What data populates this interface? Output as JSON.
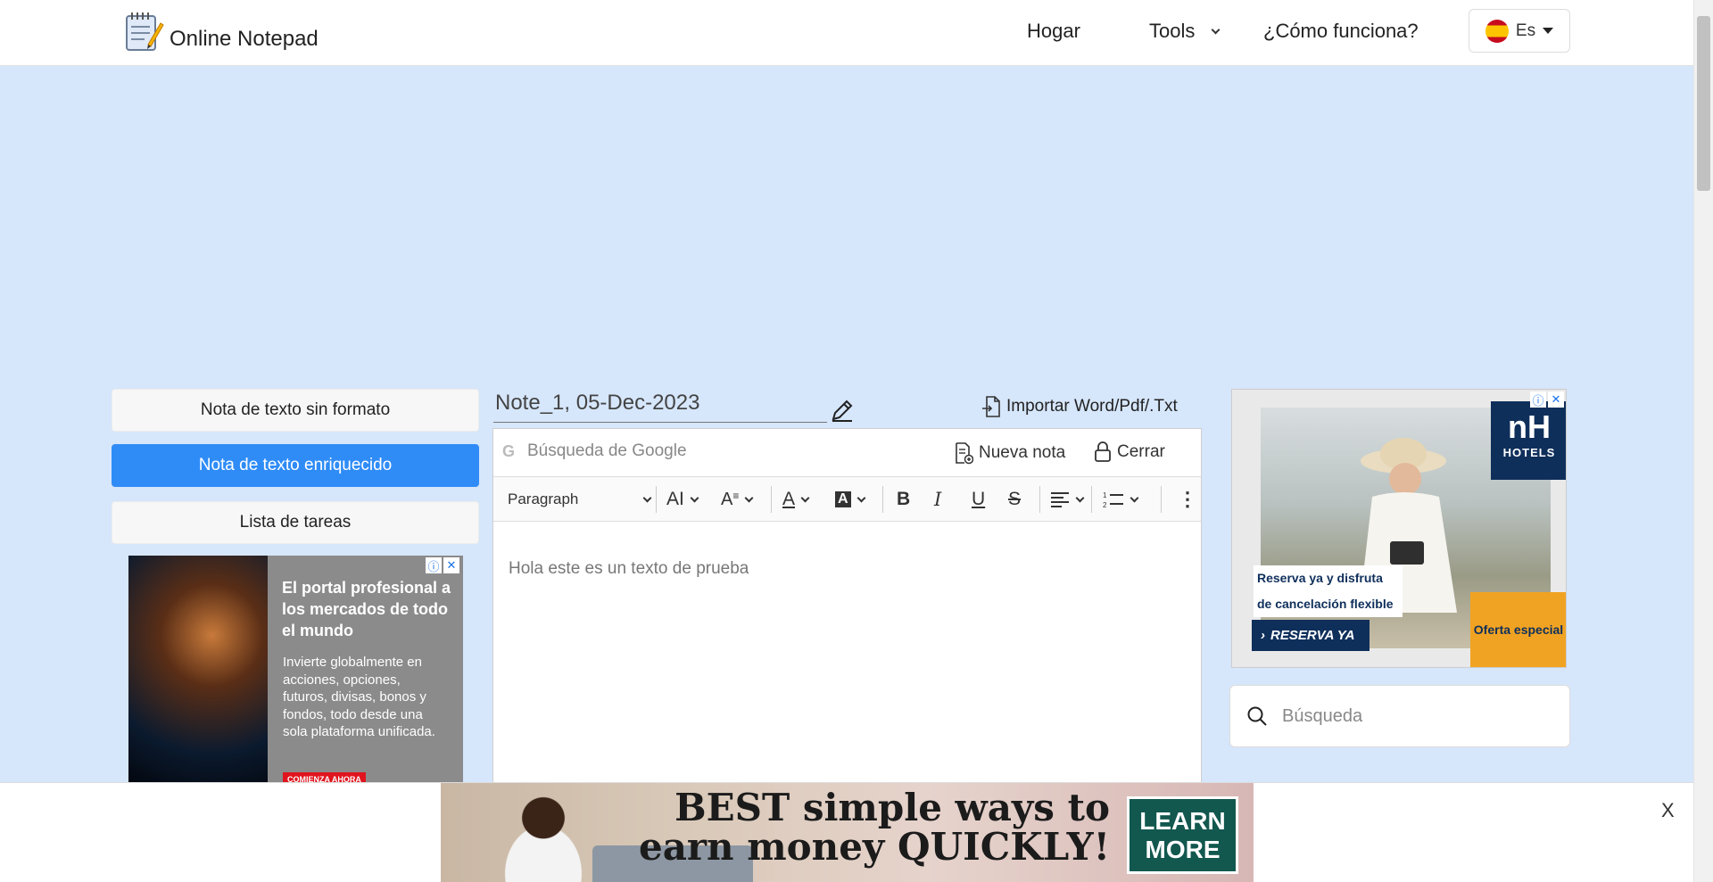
{
  "header": {
    "site_name": "Online Notepad",
    "nav": {
      "home": "Hogar",
      "tools": "Tools",
      "how": "¿Cómo funciona?"
    },
    "lang": "Es"
  },
  "sidebar": {
    "items": [
      {
        "label": "Nota de texto sin formato",
        "active": false
      },
      {
        "label": "Nota de texto enriquecido",
        "active": true
      },
      {
        "label": "Lista de tareas",
        "active": false
      }
    ]
  },
  "ad_left": {
    "title": "El portal profesional a los mercados de todo el mundo",
    "body": "Invierte globalmente en acciones, opciones, futuros, divisas, bonos y fondos, todo desde una sola plataforma unificada.",
    "cta": "COMIENZA AHORA"
  },
  "editor": {
    "note_title": "Note_1, 05-Dec-2023",
    "import_label": "Importar Word/Pdf/.Txt",
    "google_placeholder": "Búsqueda de Google",
    "new_note": "Nueva nota",
    "close": "Cerrar",
    "paragraph_select": "Paragraph",
    "content": "Hola este es un texto de prueba"
  },
  "ad_right": {
    "brand": "nH",
    "brand_sub": "HOTELS",
    "text": "Reserva ya y disfruta de cancelación flexible",
    "cta": "RESERVA YA",
    "offer": "Oferta especial"
  },
  "search": {
    "placeholder": "Búsqueda"
  },
  "bottom_ad": {
    "headline": "BEST simple ways to earn money QUICKLY!",
    "cta": "LEARN MORE",
    "close": "X"
  },
  "colors": {
    "accent": "#2f8cf7",
    "page_bg": "#d6e6fb"
  }
}
